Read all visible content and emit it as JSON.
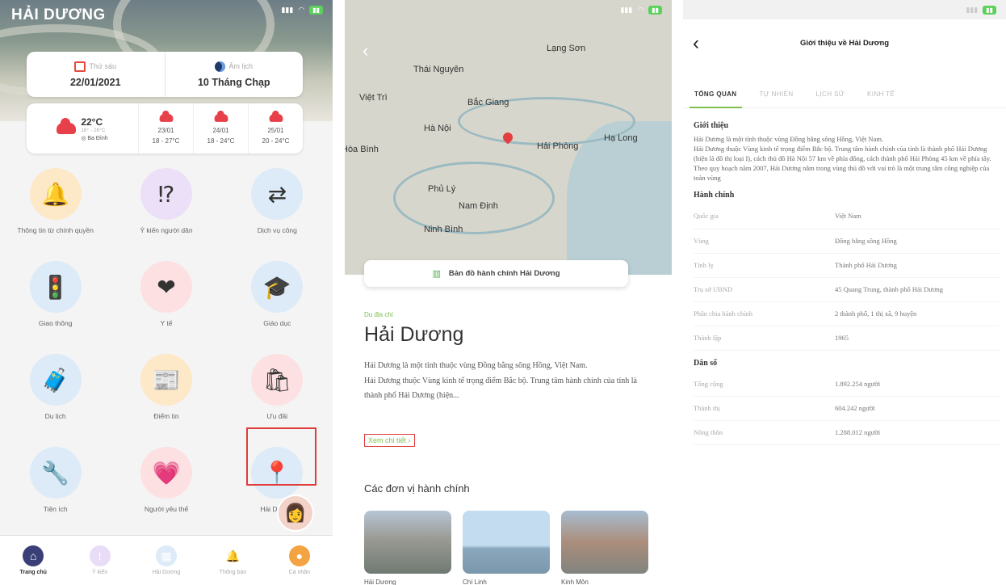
{
  "s1": {
    "brand": "HẢI DƯƠNG",
    "date": {
      "label": "Thứ sáu",
      "value": "22/01/2021"
    },
    "lunar": {
      "label": "Âm lịch",
      "value": "10 Tháng Chạp"
    },
    "weather_main": {
      "temp": "22°C",
      "range": "16° - 26°C",
      "location": "Ba Đình"
    },
    "forecast": [
      {
        "date": "23/01",
        "range": "18 - 27°C"
      },
      {
        "date": "24/01",
        "range": "18 - 24°C"
      },
      {
        "date": "25/01",
        "range": "20 - 24°C"
      }
    ],
    "tiles": [
      {
        "label": "Thông tin từ chính quyền",
        "icon": "bell-icon",
        "glyph": "🔔",
        "bg": "#fde8c8"
      },
      {
        "label": "Ý kiến người dân",
        "icon": "speech-bubble-icon",
        "glyph": "⁉",
        "bg": "#ece0f8"
      },
      {
        "label": "Dịch vụ công",
        "icon": "exchange-icon",
        "glyph": "⇄",
        "bg": "#dcebf7"
      },
      {
        "label": "Giao thông",
        "icon": "traffic-light-icon",
        "glyph": "🚦",
        "bg": "#dcebf7"
      },
      {
        "label": "Y tế",
        "icon": "heart-pulse-icon",
        "glyph": "❤",
        "bg": "#fde0e2"
      },
      {
        "label": "Giáo dục",
        "icon": "graduation-icon",
        "glyph": "🎓",
        "bg": "#dcebf7"
      },
      {
        "label": "Du lịch",
        "icon": "luggage-icon",
        "glyph": "🧳",
        "bg": "#dcebf7"
      },
      {
        "label": "Điểm tin",
        "icon": "newspaper-icon",
        "glyph": "📰",
        "bg": "#fde8c8"
      },
      {
        "label": "Ưu đãi",
        "icon": "shopping-bag-icon",
        "glyph": "🛍",
        "bg": "#fde0e2"
      },
      {
        "label": "Tiện ích",
        "icon": "tools-icon",
        "glyph": "🔧",
        "bg": "#dcebf7"
      },
      {
        "label": "Người yêu thể",
        "icon": "heart-hand-icon",
        "glyph": "💗",
        "bg": "#fde0e2"
      },
      {
        "label": "Hải Dương",
        "icon": "map-pin-icon",
        "glyph": "📍",
        "bg": "#dcebf7"
      }
    ],
    "nav": [
      {
        "label": "Trang chủ",
        "icon": "home-icon",
        "glyph": "⌂",
        "bg": "#3a3f77",
        "active": true
      },
      {
        "label": "Ý kiến",
        "icon": "speech-bubble-icon",
        "glyph": "!",
        "bg": "#e8dcf7",
        "active": false
      },
      {
        "label": "Hải Dương",
        "icon": "map-icon",
        "glyph": "▦",
        "bg": "#dcebf7",
        "active": false
      },
      {
        "label": "Thông báo",
        "icon": "bell-icon",
        "glyph": "🔔",
        "bg": "#fff",
        "active": false
      },
      {
        "label": "Cá nhân",
        "icon": "user-icon",
        "glyph": "●",
        "bg": "#f4a342",
        "active": false
      }
    ]
  },
  "s2": {
    "map_button": "Bản đồ hành chính Hải Dương",
    "cities": [
      "Lạng Sơn",
      "Thái Nguyên",
      "Việt Trì",
      "Bắc Giang",
      "Hà Nội",
      "Hải Phòng",
      "Hạ Long",
      "Hòa Bình",
      "Phủ Lý",
      "Nam Định",
      "Ninh Bình"
    ],
    "category": "Du địa chí",
    "title": "Hải Dương",
    "description": "Hải Dương là một tỉnh thuộc vùng Đồng bằng sông Hồng, Việt Nam.\nHải Dương thuộc Vùng kinh tế trọng điểm Bắc bộ. Trung tâm hành chính của tỉnh là thành phố Hải Dương (hiện...",
    "more": "Xem chi tiết",
    "section": "Các đơn vị hành chính",
    "thumbs": [
      "Hải Dương",
      "Chí Linh",
      "Kinh Môn"
    ]
  },
  "s3": {
    "title": "Giới thiệu về Hải Dương",
    "tabs": [
      "TỔNG QUAN",
      "TỰ NHIÊN",
      "LỊCH SỬ",
      "KINH TẾ"
    ],
    "intro_heading": "Giới thiệu",
    "intro_text": "Hải Dương là một tỉnh thuộc vùng Đồng bằng sông Hồng, Việt Nam.\nHải Dương thuộc Vùng kinh tế trọng điểm Bắc bộ. Trung tâm hành chính của tỉnh là thành phố Hải Dương (hiện là đô thị loại I), cách thủ đô Hà Nội 57 km về phía đông, cách thành phố Hải Phòng 45 km về phía tây.\nTheo quy hoạch năm 2007, Hải Dương nằm trong vùng thủ đô với vai trò là một trung tâm công nghiệp của toàn vùng",
    "admin_heading": "Hành chính",
    "admin": [
      {
        "k": "Quốc gia",
        "v": "Việt Nam"
      },
      {
        "k": "Vùng",
        "v": "Đồng bằng sông Hồng"
      },
      {
        "k": "Tỉnh lỵ",
        "v": "Thành phố Hải Dương"
      },
      {
        "k": "Trụ sở UBND",
        "v": "45 Quang Trung, thành phố Hải Dương"
      },
      {
        "k": "Phân chia hành chính",
        "v": "2 thành phố, 1 thị xã, 9 huyện"
      },
      {
        "k": "Thành lập",
        "v": "1965"
      }
    ],
    "pop_heading": "Dân số",
    "population": [
      {
        "k": "Tổng cộng",
        "v": "1.892.254 người"
      },
      {
        "k": "Thành thị",
        "v": "604.242 người"
      },
      {
        "k": "Nông thôn",
        "v": "1.288.012 người"
      }
    ]
  }
}
